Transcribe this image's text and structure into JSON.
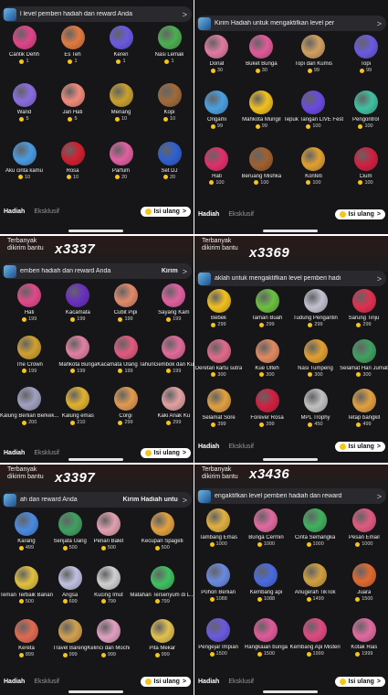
{
  "common": {
    "tab_hadiah": "Hadiah",
    "tab_eksklusif": "Eksklusif",
    "recharge": "Isi ulang",
    "chevron": ">",
    "coin_color": "#f5c518"
  },
  "panels": [
    {
      "bar_text": "l level pemberi hadiah dan reward Anda",
      "items": [
        {
          "name": "Cantik Dehh",
          "price": "1",
          "icon": "gem-text-icon",
          "color": "#e0458a"
        },
        {
          "name": "Es Teh",
          "price": "1",
          "icon": "iced-tea-icon",
          "color": "#e07a40"
        },
        {
          "name": "Keren",
          "price": "1",
          "icon": "cool-text-icon",
          "color": "#6a5ae0"
        },
        {
          "name": "Nasi Lemak",
          "price": "1",
          "icon": "nasi-lemak-icon",
          "color": "#4caf50"
        },
        {
          "name": "Wand",
          "price": "5",
          "icon": "wand-icon",
          "color": "#8a6de0"
        },
        {
          "name": "Jari Hati",
          "price": "5",
          "icon": "finger-heart-icon",
          "color": "#f08a7a"
        },
        {
          "name": "Menang",
          "price": "10",
          "icon": "victory-icon",
          "color": "#c8a030"
        },
        {
          "name": "Kopi",
          "price": "10",
          "icon": "coffee-icon",
          "color": "#a06a3a"
        },
        {
          "name": "Aku cinta kamu",
          "price": "10",
          "icon": "love-you-icon",
          "color": "#4a9ae0"
        },
        {
          "name": "Rosa",
          "price": "10",
          "icon": "rose-icon",
          "color": "#d02030"
        },
        {
          "name": "Parfum",
          "price": "20",
          "icon": "perfume-icon",
          "color": "#e060a0"
        },
        {
          "name": "Set DJ",
          "price": "20",
          "icon": "dj-icon",
          "color": "#3060d0"
        }
      ]
    },
    {
      "bar_text": "Kirim Hadiah untuk mengaktifkan level per",
      "items": [
        {
          "name": "Donat",
          "price": "30",
          "icon": "donut-icon",
          "color": "#e07aa0"
        },
        {
          "name": "Buket Bunga",
          "price": "30",
          "icon": "bouquet-icon",
          "color": "#e05a9a"
        },
        {
          "name": "Topi dan Kumis",
          "price": "99",
          "icon": "hat-mustache-icon",
          "color": "#d0a060"
        },
        {
          "name": "Topi",
          "price": "99",
          "icon": "hat-icon",
          "color": "#6a5ae0"
        },
        {
          "name": "Origami",
          "price": "99",
          "icon": "origami-icon",
          "color": "#4aa0e0"
        },
        {
          "name": "Mahkota Mungil",
          "price": "99",
          "icon": "crown-icon",
          "color": "#f0c020"
        },
        {
          "name": "Tepuk Tangan LIVE Fest",
          "price": "100",
          "icon": "clap-icon",
          "color": "#6a4ae0"
        },
        {
          "name": "Pengontrol",
          "price": "100",
          "icon": "controller-icon",
          "color": "#40c0a0"
        },
        {
          "name": "Hati",
          "price": "100",
          "icon": "heart-icon",
          "color": "#e0306a"
        },
        {
          "name": "Beruang Mishka",
          "price": "100",
          "icon": "bear-icon",
          "color": "#a06030"
        },
        {
          "name": "Konfeti",
          "price": "100",
          "icon": "confetti-icon",
          "color": "#e0a030"
        },
        {
          "name": "Cium",
          "price": "100",
          "icon": "lips-icon",
          "color": "#d02040"
        }
      ]
    },
    {
      "float_label": "Terbanyak dikirim bantu",
      "count": "x3337",
      "bar_text": "emberi hadiah dan reward Anda",
      "bar_btn": "Kirim",
      "items": [
        {
          "name": "Hati",
          "price": "199",
          "icon": "heart-icon",
          "color": "#e04a8a"
        },
        {
          "name": "Kacamata",
          "price": "199",
          "icon": "glasses-icon",
          "color": "#6a30c0"
        },
        {
          "name": "Cubit Pipi",
          "price": "199",
          "icon": "pinch-icon",
          "color": "#e08a6a"
        },
        {
          "name": "Sayang Kam",
          "price": "199",
          "icon": "love-icon",
          "color": "#e060a0"
        },
        {
          "name": "The Crown",
          "price": "199",
          "icon": "crown-icon",
          "color": "#d0a030"
        },
        {
          "name": "Mahkota Bunga",
          "price": "199",
          "icon": "flower-crown-icon",
          "color": "#e080a0"
        },
        {
          "name": "Kacamata Ulang Tahun",
          "price": "199",
          "icon": "birthday-glasses-icon",
          "color": "#e05a80"
        },
        {
          "name": "Gembok dan Ku",
          "price": "199",
          "icon": "padlock-icon",
          "color": "#e06a9a"
        },
        {
          "name": "Kalung Berlian Berkek...",
          "price": "200",
          "icon": "necklace-icon",
          "color": "#a0a0c0"
        },
        {
          "name": "Kalung emas",
          "price": "210",
          "icon": "gold-necklace-icon",
          "color": "#e0b030"
        },
        {
          "name": "Corgi",
          "price": "299",
          "icon": "corgi-icon",
          "color": "#e09a50"
        },
        {
          "name": "Kaki Anak Ku",
          "price": "299",
          "icon": "baby-feet-icon",
          "color": "#e0a0a0"
        }
      ]
    },
    {
      "float_label": "Terbanyak dikirim bantu",
      "count": "x3369",
      "bar_text": "aklah untuk mengaktifkan level pemberi hadi",
      "items": [
        {
          "name": "Bebek",
          "price": "299",
          "icon": "duck-icon",
          "color": "#f0c020"
        },
        {
          "name": "Taman Buah",
          "price": "299",
          "icon": "fruit-icon",
          "color": "#6ac040"
        },
        {
          "name": "Tudung Pengantin",
          "price": "299",
          "icon": "veil-icon",
          "color": "#c0c0d0"
        },
        {
          "name": "Sarung Tinju",
          "price": "299",
          "icon": "boxing-glove-icon",
          "color": "#e03050"
        },
        {
          "name": "Deretan kartu sutra",
          "price": "300",
          "icon": "cards-icon",
          "color": "#e06a8a"
        },
        {
          "name": "Kue Ulteh",
          "price": "300",
          "icon": "cake-icon",
          "color": "#e08a60"
        },
        {
          "name": "Nasi Tumpeng",
          "price": "300",
          "icon": "tumpeng-icon",
          "color": "#e0a030"
        },
        {
          "name": "Selamat Hari Jumat",
          "price": "300",
          "icon": "friday-icon",
          "color": "#40a060"
        },
        {
          "name": "Selamat Sore",
          "price": "399",
          "icon": "sunset-icon",
          "color": "#e0a040"
        },
        {
          "name": "Forever Rosa",
          "price": "399",
          "icon": "rose-box-icon",
          "color": "#d02040"
        },
        {
          "name": "MPL Trophy",
          "price": "450",
          "icon": "trophy-icon",
          "color": "#c0c0c0"
        },
        {
          "name": "Tetap bangkit",
          "price": "499",
          "icon": "stand-up-icon",
          "color": "#e0a040"
        }
      ]
    },
    {
      "float_label": "Terbanyak dikirim bantu",
      "count": "x3397",
      "bar_text": "ah dan reward Anda",
      "bar_btn": "Kirim Hadiah untu",
      "items": [
        {
          "name": "Karang",
          "price": "499",
          "icon": "coral-icon",
          "color": "#4a8ae0"
        },
        {
          "name": "Senjata Uang",
          "price": "500",
          "icon": "money-gun-icon",
          "color": "#40a060"
        },
        {
          "name": "Penari Balet",
          "price": "500",
          "icon": "ballerina-icon",
          "color": "#e0a0b0"
        },
        {
          "name": "Kecupan Spageti",
          "price": "500",
          "icon": "spaghetti-icon",
          "color": "#e0a040"
        },
        {
          "name": "Teman Terbaik Barian",
          "price": "500",
          "icon": "bestie-icon",
          "color": "#e0c040"
        },
        {
          "name": "Angsa",
          "price": "699",
          "icon": "swan-icon",
          "color": "#c0c0e0"
        },
        {
          "name": "Kucing Imut",
          "price": "799",
          "icon": "cat-icon",
          "color": "#d0d0d0"
        },
        {
          "name": "Matahari Tersenyum di L...",
          "price": "799",
          "icon": "sun-icon",
          "color": "#40c060"
        },
        {
          "name": "Kereta",
          "price": "899",
          "icon": "train-icon",
          "color": "#e06a50"
        },
        {
          "name": "Travel Bareng",
          "price": "999",
          "icon": "travel-icon",
          "color": "#d0a050"
        },
        {
          "name": "Kelinci dan Mochi",
          "price": "999",
          "icon": "bunny-icon",
          "color": "#e0a0c0"
        },
        {
          "name": "Pita Mekar",
          "price": "999",
          "icon": "ribbon-icon",
          "color": "#e0c050"
        }
      ]
    },
    {
      "float_label": "Terbanyak dikirim bantu",
      "count": "x3436",
      "bar_text": "engaktifkan level pemberi hadiah dan reward",
      "items": [
        {
          "name": "Tambang Emas",
          "price": "1000",
          "icon": "gold-mine-icon",
          "color": "#e0b040"
        },
        {
          "name": "Bunga Cermin",
          "price": "1000",
          "icon": "mirror-flower-icon",
          "color": "#e06aa0"
        },
        {
          "name": "Cinta Semangka",
          "price": "1000",
          "icon": "watermelon-icon",
          "color": "#40b060"
        },
        {
          "name": "Pesan Email",
          "price": "1000",
          "icon": "email-icon",
          "color": "#e05a80"
        },
        {
          "name": "Pohon Berlian",
          "price": "1088",
          "icon": "diamond-tree-icon",
          "color": "#6a8ae0"
        },
        {
          "name": "Kembang api",
          "price": "1088",
          "icon": "fireworks-icon",
          "color": "#4a6ae0"
        },
        {
          "name": "Anugerah TikTok",
          "price": "1499",
          "icon": "award-icon",
          "color": "#d0a040"
        },
        {
          "name": "Juara",
          "price": "1500",
          "icon": "champion-icon",
          "color": "#e06a30"
        },
        {
          "name": "Pengejar Impian",
          "price": "1500",
          "icon": "dream-icon",
          "color": "#6a5ae0"
        },
        {
          "name": "Rangkaian bunga",
          "price": "1500",
          "icon": "garland-icon",
          "color": "#e05a9a"
        },
        {
          "name": "Kembang Api Misteri",
          "price": "1999",
          "icon": "mystery-fireworks-icon",
          "color": "#e04a80"
        },
        {
          "name": "Kotak Rias",
          "price": "1999",
          "icon": "makeup-box-icon",
          "color": "#e06aa0"
        }
      ]
    }
  ]
}
